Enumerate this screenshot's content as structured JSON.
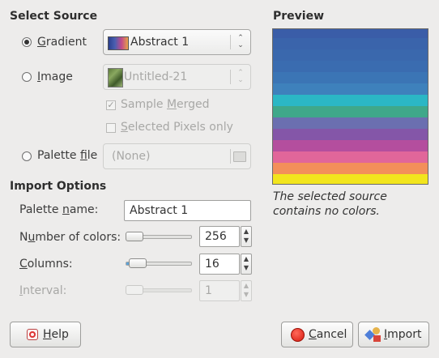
{
  "select_source": {
    "heading": "Select Source",
    "gradient": {
      "label_pre": "",
      "mnemonic": "G",
      "label_post": "radient",
      "selected": true,
      "value": "Abstract 1"
    },
    "image": {
      "label_pre": "",
      "mnemonic": "I",
      "label_post": "mage",
      "value": "Untitled-21"
    },
    "sample_merged": {
      "label_pre": "Sample ",
      "mnemonic": "M",
      "label_post": "erged",
      "checked": true
    },
    "selected_pixels_only": {
      "label_pre": "",
      "mnemonic": "S",
      "label_post": "elected Pixels only",
      "checked": false
    },
    "palette_file": {
      "label_pre": "Palette ",
      "mnemonic": "f",
      "label_post": "ile",
      "value": "(None)"
    }
  },
  "preview": {
    "heading": "Preview",
    "message": "The selected source contains no colors.",
    "colors": [
      "#3a5da8",
      "#3a64ab",
      "#3a68ad",
      "#3a6cb0",
      "#3b75b5",
      "#3e81bc",
      "#2bb7c5",
      "#3fa88a",
      "#6b6fb0",
      "#8456a8",
      "#b44e9e",
      "#e1669a",
      "#f38f5a",
      "#f2e51d"
    ]
  },
  "import_options": {
    "heading": "Import Options",
    "palette_name": {
      "label_pre": "Palette ",
      "mnemonic": "n",
      "label_post": "ame:",
      "value": "Abstract 1"
    },
    "number_of_colors": {
      "label_pre": "N",
      "mnemonic": "u",
      "label_post": "mber of colors:",
      "value": "256",
      "level": 0.0
    },
    "columns": {
      "label_pre": "",
      "mnemonic": "C",
      "label_post": "olumns:",
      "value": "16",
      "level": 0.06
    },
    "interval": {
      "label_pre": "",
      "mnemonic": "I",
      "label_post": "nterval:",
      "value": "1",
      "level": 0.0
    }
  },
  "buttons": {
    "help": {
      "mnemonic": "H",
      "label_post": "elp",
      "icon": "help-lifebuoy-icon"
    },
    "cancel": {
      "mnemonic": "C",
      "label_post": "ancel",
      "icon": "cancel-stop-icon"
    },
    "import": {
      "mnemonic": "I",
      "label_post": "mport",
      "icon": "import-shapes-icon"
    }
  }
}
